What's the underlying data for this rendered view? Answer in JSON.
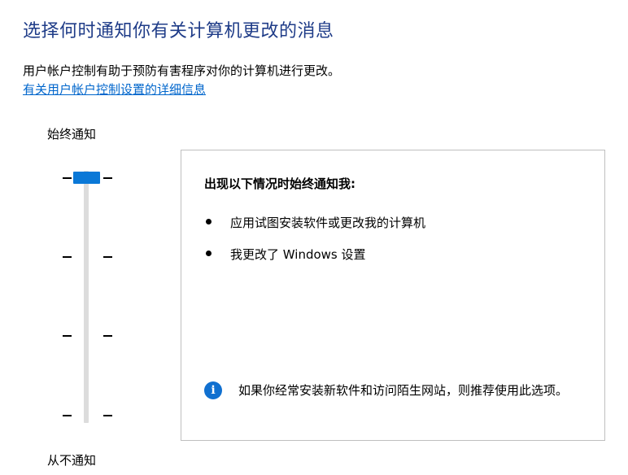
{
  "header": {
    "title": "选择何时通知你有关计算机更改的消息",
    "description": "用户帐户控制有助于预防有害程序对你的计算机进行更改。",
    "link_text": "有关用户帐户控制设置的详细信息"
  },
  "slider": {
    "top_label": "始终通知",
    "bottom_label": "从不通知",
    "level_count": 4,
    "selected_level": "始终通知"
  },
  "panel": {
    "heading": "出现以下情况时始终通知我:",
    "bullets": [
      "应用试图安装软件或更改我的计算机",
      "我更改了 Windows 设置"
    ],
    "info_text": "如果你经常安装新软件和访问陌生网站，则推荐使用此选项。"
  },
  "colors": {
    "title": "#1f3c88",
    "link": "#0066cc",
    "slider_thumb": "#0a78d7",
    "info_icon": "#1070d0"
  }
}
